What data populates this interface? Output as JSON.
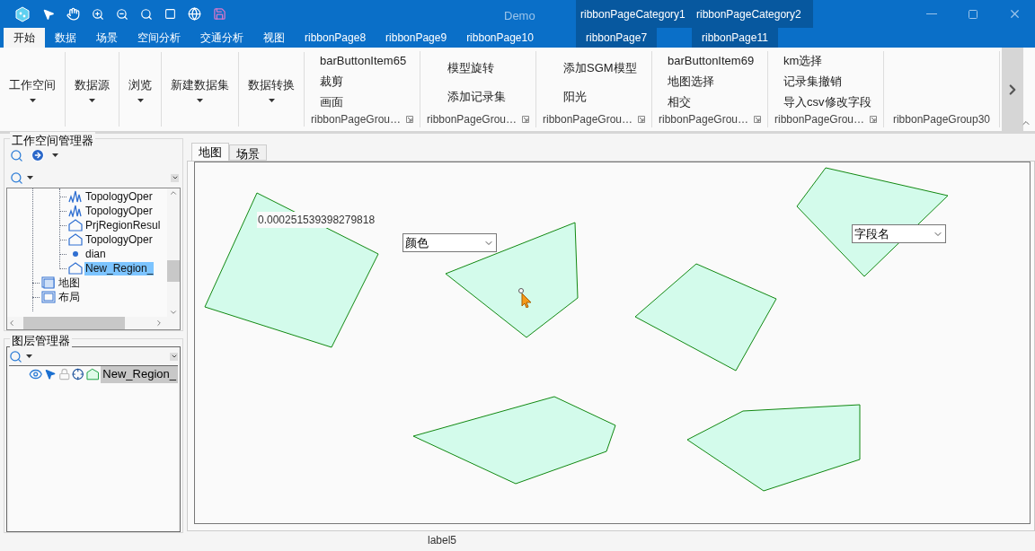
{
  "window": {
    "title": "Demo",
    "categories": [
      "ribbonPageCategory1",
      "ribbonPageCategory2"
    ]
  },
  "ribbon_tabs": [
    {
      "label": "开始",
      "selected": true,
      "kind": "normal"
    },
    {
      "label": "数据",
      "selected": false,
      "kind": "normal"
    },
    {
      "label": "场景",
      "selected": false,
      "kind": "normal"
    },
    {
      "label": "空间分析",
      "selected": false,
      "kind": "normal"
    },
    {
      "label": "交通分析",
      "selected": false,
      "kind": "normal"
    },
    {
      "label": "视图",
      "selected": false,
      "kind": "normal"
    },
    {
      "label": "ribbonPage8",
      "selected": false,
      "kind": "normal"
    },
    {
      "label": "ribbonPage9",
      "selected": false,
      "kind": "normal"
    },
    {
      "label": "ribbonPage10",
      "selected": false,
      "kind": "normal"
    },
    {
      "label": "ribbonPage7",
      "selected": false,
      "kind": "contextual"
    },
    {
      "label": "ribbonPage11",
      "selected": false,
      "kind": "contextual"
    }
  ],
  "ribbon_buttons": [
    {
      "label": "工作空间"
    },
    {
      "label": "数据源"
    },
    {
      "label": "浏览"
    },
    {
      "label": "新建数据集"
    },
    {
      "label": "数据转换"
    }
  ],
  "ribbon_groups": [
    {
      "items": [
        "barButtonItem65",
        "裁剪",
        "画面"
      ],
      "caption": "ribbonPageGrou…",
      "launcher": true
    },
    {
      "items": [
        "模型旋转",
        "添加记录集"
      ],
      "caption": "ribbonPageGrou…",
      "launcher": true
    },
    {
      "items": [
        "添加SGM模型",
        "阳光"
      ],
      "caption": "ribbonPageGrou…",
      "launcher": true
    },
    {
      "items": [
        "barButtonItem69",
        "地图选择",
        "相交"
      ],
      "caption": "ribbonPageGrou…",
      "launcher": true
    },
    {
      "items": [
        "km选择",
        "记录集撤销",
        "导入csv修改字段"
      ],
      "caption": "ribbonPageGrou…",
      "launcher": true
    },
    {
      "caption": "ribbonPageGroup30",
      "launcher": false
    }
  ],
  "workspace_manager": {
    "title": "工作空间管理器",
    "tree": [
      {
        "children": [
          {
            "label": "TopologyOper",
            "kind": "line",
            "selected": false
          },
          {
            "label": "TopologyOper",
            "kind": "line",
            "selected": false
          },
          {
            "label": "PrjRegionResul",
            "kind": "region",
            "selected": false
          },
          {
            "label": "TopologyOper",
            "kind": "region",
            "selected": false
          },
          {
            "label": "dian",
            "kind": "point",
            "selected": false
          },
          {
            "label": "New_Region_",
            "kind": "region",
            "selected": true
          }
        ]
      },
      {
        "label": "地图",
        "kind": "map",
        "selected": false
      },
      {
        "label": "布局",
        "kind": "layout",
        "selected": false
      }
    ]
  },
  "layer_manager": {
    "title": "图层管理器",
    "layers": [
      {
        "name": "New_Region_",
        "visible": true,
        "selectable": true,
        "editable": false,
        "snappable": true
      }
    ]
  },
  "map_tabs": [
    {
      "label": "地图",
      "selected": true
    },
    {
      "label": "场景",
      "selected": false
    }
  ],
  "map": {
    "value_label": "0.000251539398279818",
    "dropdowns": [
      {
        "value": "颜色"
      },
      {
        "value": "字段名"
      }
    ]
  },
  "status_bar": {
    "label": "label5"
  }
}
